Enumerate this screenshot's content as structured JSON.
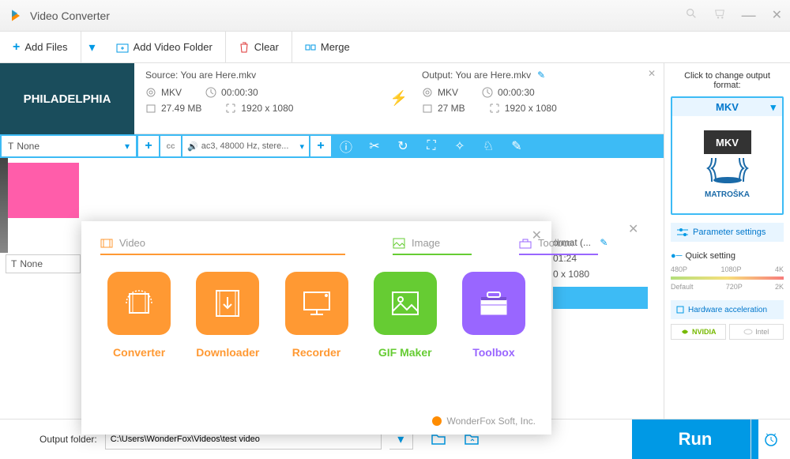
{
  "app": {
    "title": "Video Converter"
  },
  "toolbar": {
    "add_files": "Add Files",
    "add_folder": "Add Video Folder",
    "clear": "Clear",
    "merge": "Merge"
  },
  "file1": {
    "thumb_text": "PHILADELPHIA",
    "source": {
      "label": "Source: You are Here.mkv",
      "format": "MKV",
      "duration": "00:00:30",
      "size": "27.49 MB",
      "dims": "1920 x 1080"
    },
    "output": {
      "label": "Output: You are Here.mkv",
      "format": "MKV",
      "duration": "00:00:30",
      "size": "27 MB",
      "dims": "1920 x 1080"
    },
    "subtitle": "None",
    "audio": "ac3, 48000 Hz, stere..."
  },
  "file2": {
    "output_trunc": "ormat (...",
    "duration": "01:24",
    "dims": "0 x 1080",
    "subtitle": "None"
  },
  "popup": {
    "tab_video": "Video",
    "tab_image": "Image",
    "tab_toolbox": "Toolbox",
    "tiles": {
      "converter": "Converter",
      "downloader": "Downloader",
      "recorder": "Recorder",
      "gif": "GIF Maker",
      "toolbox": "Toolbox"
    },
    "footer": "WonderFox Soft, Inc."
  },
  "right": {
    "header": "Click to change output format:",
    "format": "MKV",
    "matroska": "MATROŠKA",
    "param": "Parameter settings",
    "quick": "Quick setting",
    "marks_top": [
      "480P",
      "1080P",
      "4K"
    ],
    "marks_bot": [
      "Default",
      "720P",
      "2K"
    ],
    "hw": "Hardware acceleration",
    "nvidia": "NVIDIA",
    "intel": "Intel"
  },
  "footer": {
    "label": "Output folder:",
    "path": "C:\\Users\\WonderFox\\Videos\\test video",
    "run": "Run"
  }
}
